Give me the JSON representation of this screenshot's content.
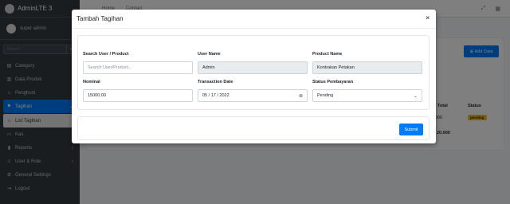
{
  "sidebar": {
    "brand": "AdminLTE 3",
    "user": "super admin",
    "search_placeholder": "Search",
    "items": [
      {
        "label": "Category",
        "icon": "list-icon",
        "arrow": true
      },
      {
        "label": "Data Produk",
        "icon": "book-icon",
        "arrow": true
      },
      {
        "label": "Penghuni",
        "icon": "home-icon",
        "arrow": true
      },
      {
        "label": "Tagihan",
        "icon": "tag-icon",
        "arrow": true,
        "active": true
      },
      {
        "label": "List Tagihan",
        "icon": "circle-icon",
        "sub": true
      },
      {
        "label": "Kas",
        "icon": "cash-icon"
      },
      {
        "label": "Reports",
        "icon": "chart-icon",
        "arrow": true
      },
      {
        "label": "User & Role",
        "icon": "users-icon",
        "arrow": true
      },
      {
        "label": "General Settings",
        "icon": "gear-icon"
      },
      {
        "label": "Logout",
        "icon": "logout-icon"
      }
    ]
  },
  "navbar": {
    "home": "Home",
    "contact": "Contact"
  },
  "background": {
    "add_button": "Add Data",
    "col_total": "Total",
    "col_status": "Status",
    "row_total": "00.000",
    "row_status": "pending",
    "sum_total": "20.000"
  },
  "modal": {
    "title": "Tambah Tagihan",
    "close": "×",
    "fields": {
      "search": {
        "label": "Search User / Product",
        "placeholder": "Search User/Product..."
      },
      "user_name": {
        "label": "User Name",
        "value": "Admin"
      },
      "product_name": {
        "label": "Product Name",
        "value": "Kontrakan Petakan"
      },
      "nominal": {
        "label": "Nominal",
        "value": "15000.00"
      },
      "transaction_date": {
        "label": "Transaction Date",
        "value": "05 / 17 / 2022"
      },
      "status": {
        "label": "Status Pembayaran",
        "value": "Pending"
      }
    },
    "submit": "Submit"
  },
  "colors": {
    "primary": "#007bff",
    "sidebar_bg": "#343a40",
    "warning": "#ffc107"
  }
}
